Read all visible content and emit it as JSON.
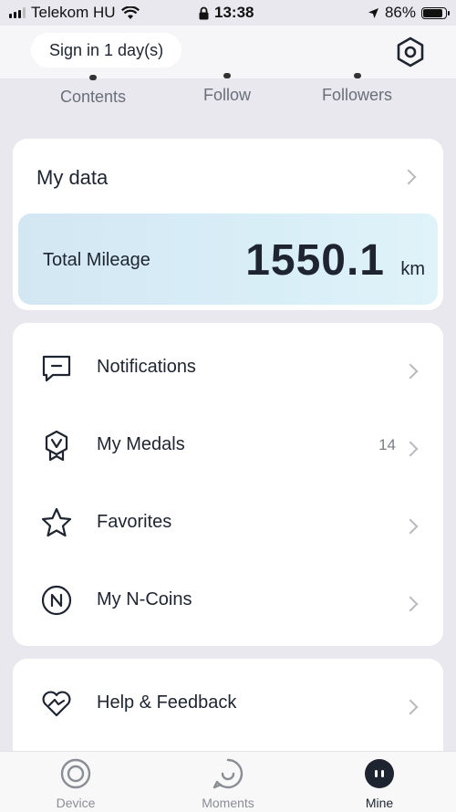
{
  "status_bar": {
    "carrier": "Telekom HU",
    "time": "13:38",
    "battery": "86%"
  },
  "header": {
    "sign_in": "Sign in 1 day(s)",
    "settings_icon": "hexagon-gear-icon"
  },
  "stats": [
    {
      "label": "Contents"
    },
    {
      "label": "Follow"
    },
    {
      "label": "Followers"
    }
  ],
  "my_data": {
    "title": "My data",
    "mileage_label": "Total Mileage",
    "mileage_value": "1550.1",
    "mileage_unit": "km"
  },
  "menu": {
    "items": [
      {
        "label": "Notifications",
        "icon": "message-icon",
        "count": ""
      },
      {
        "label": "My Medals",
        "icon": "medal-icon",
        "count": "14"
      },
      {
        "label": "Favorites",
        "icon": "star-icon",
        "count": ""
      },
      {
        "label": "My N-Coins",
        "icon": "coin-icon",
        "count": ""
      }
    ]
  },
  "help": {
    "label": "Help & Feedback",
    "icon": "heart-icon"
  },
  "tabs": [
    {
      "label": "Device",
      "icon": "device-icon",
      "active": false
    },
    {
      "label": "Moments",
      "icon": "moments-icon",
      "active": false
    },
    {
      "label": "Mine",
      "icon": "mine-icon",
      "active": true
    }
  ],
  "colors": {
    "accent_dark": "#1e2530",
    "mileage_gradient_start": "#d3e7f3",
    "mileage_gradient_end": "#dff3f9",
    "inactive_tab": "#8a8d94"
  }
}
